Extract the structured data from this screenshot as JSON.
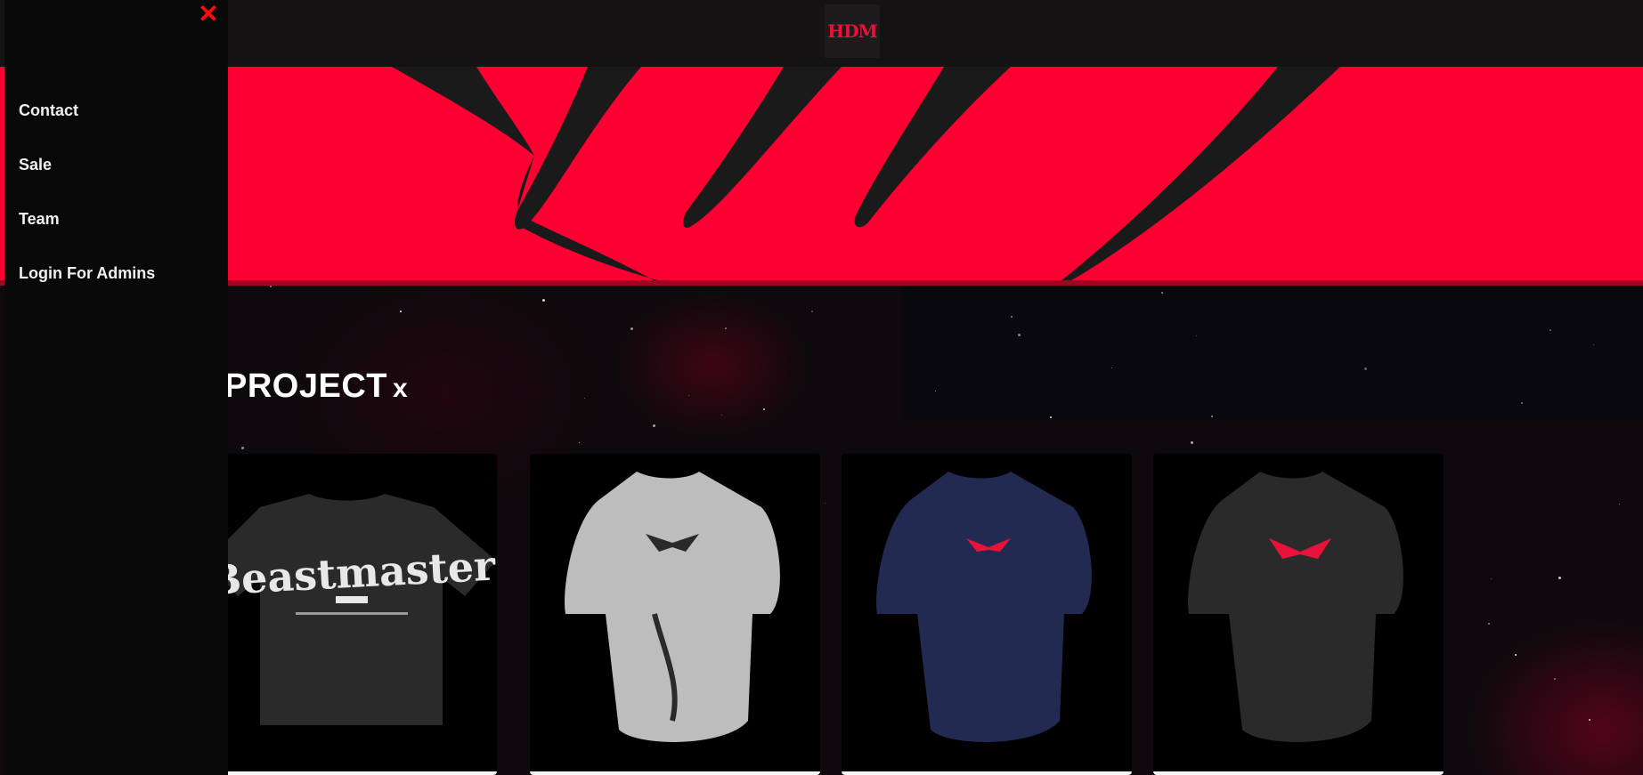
{
  "header": {
    "logo_text": "HDM",
    "logo_color": "#e8123a"
  },
  "hero": {
    "color": "#fd0032",
    "claw_color": "#1a1a1a"
  },
  "side_menu": {
    "close_glyph": "✕",
    "close_color": "#ff0a0a",
    "items": [
      {
        "label": "Contact"
      },
      {
        "label": "Sale"
      },
      {
        "label": "Team"
      },
      {
        "label": "Login For Admins"
      }
    ]
  },
  "section": {
    "title": "PROJECT",
    "title_suffix": "x"
  },
  "products": [
    {
      "image_icon": "oversized-tshirt-icon",
      "print_text": "Beastmaster",
      "color": "#2a2a2a",
      "print_color": "#e8e8e8"
    },
    {
      "image_icon": "compression-shirt-icon",
      "color": "#bdbdbd",
      "print_color": "#2a2a2a"
    },
    {
      "image_icon": "compression-shirt-icon",
      "color": "#232a52",
      "print_color": "#e8123a"
    },
    {
      "image_icon": "compression-shirt-icon",
      "color": "#2a2a2a",
      "print_color": "#e8123a"
    }
  ]
}
